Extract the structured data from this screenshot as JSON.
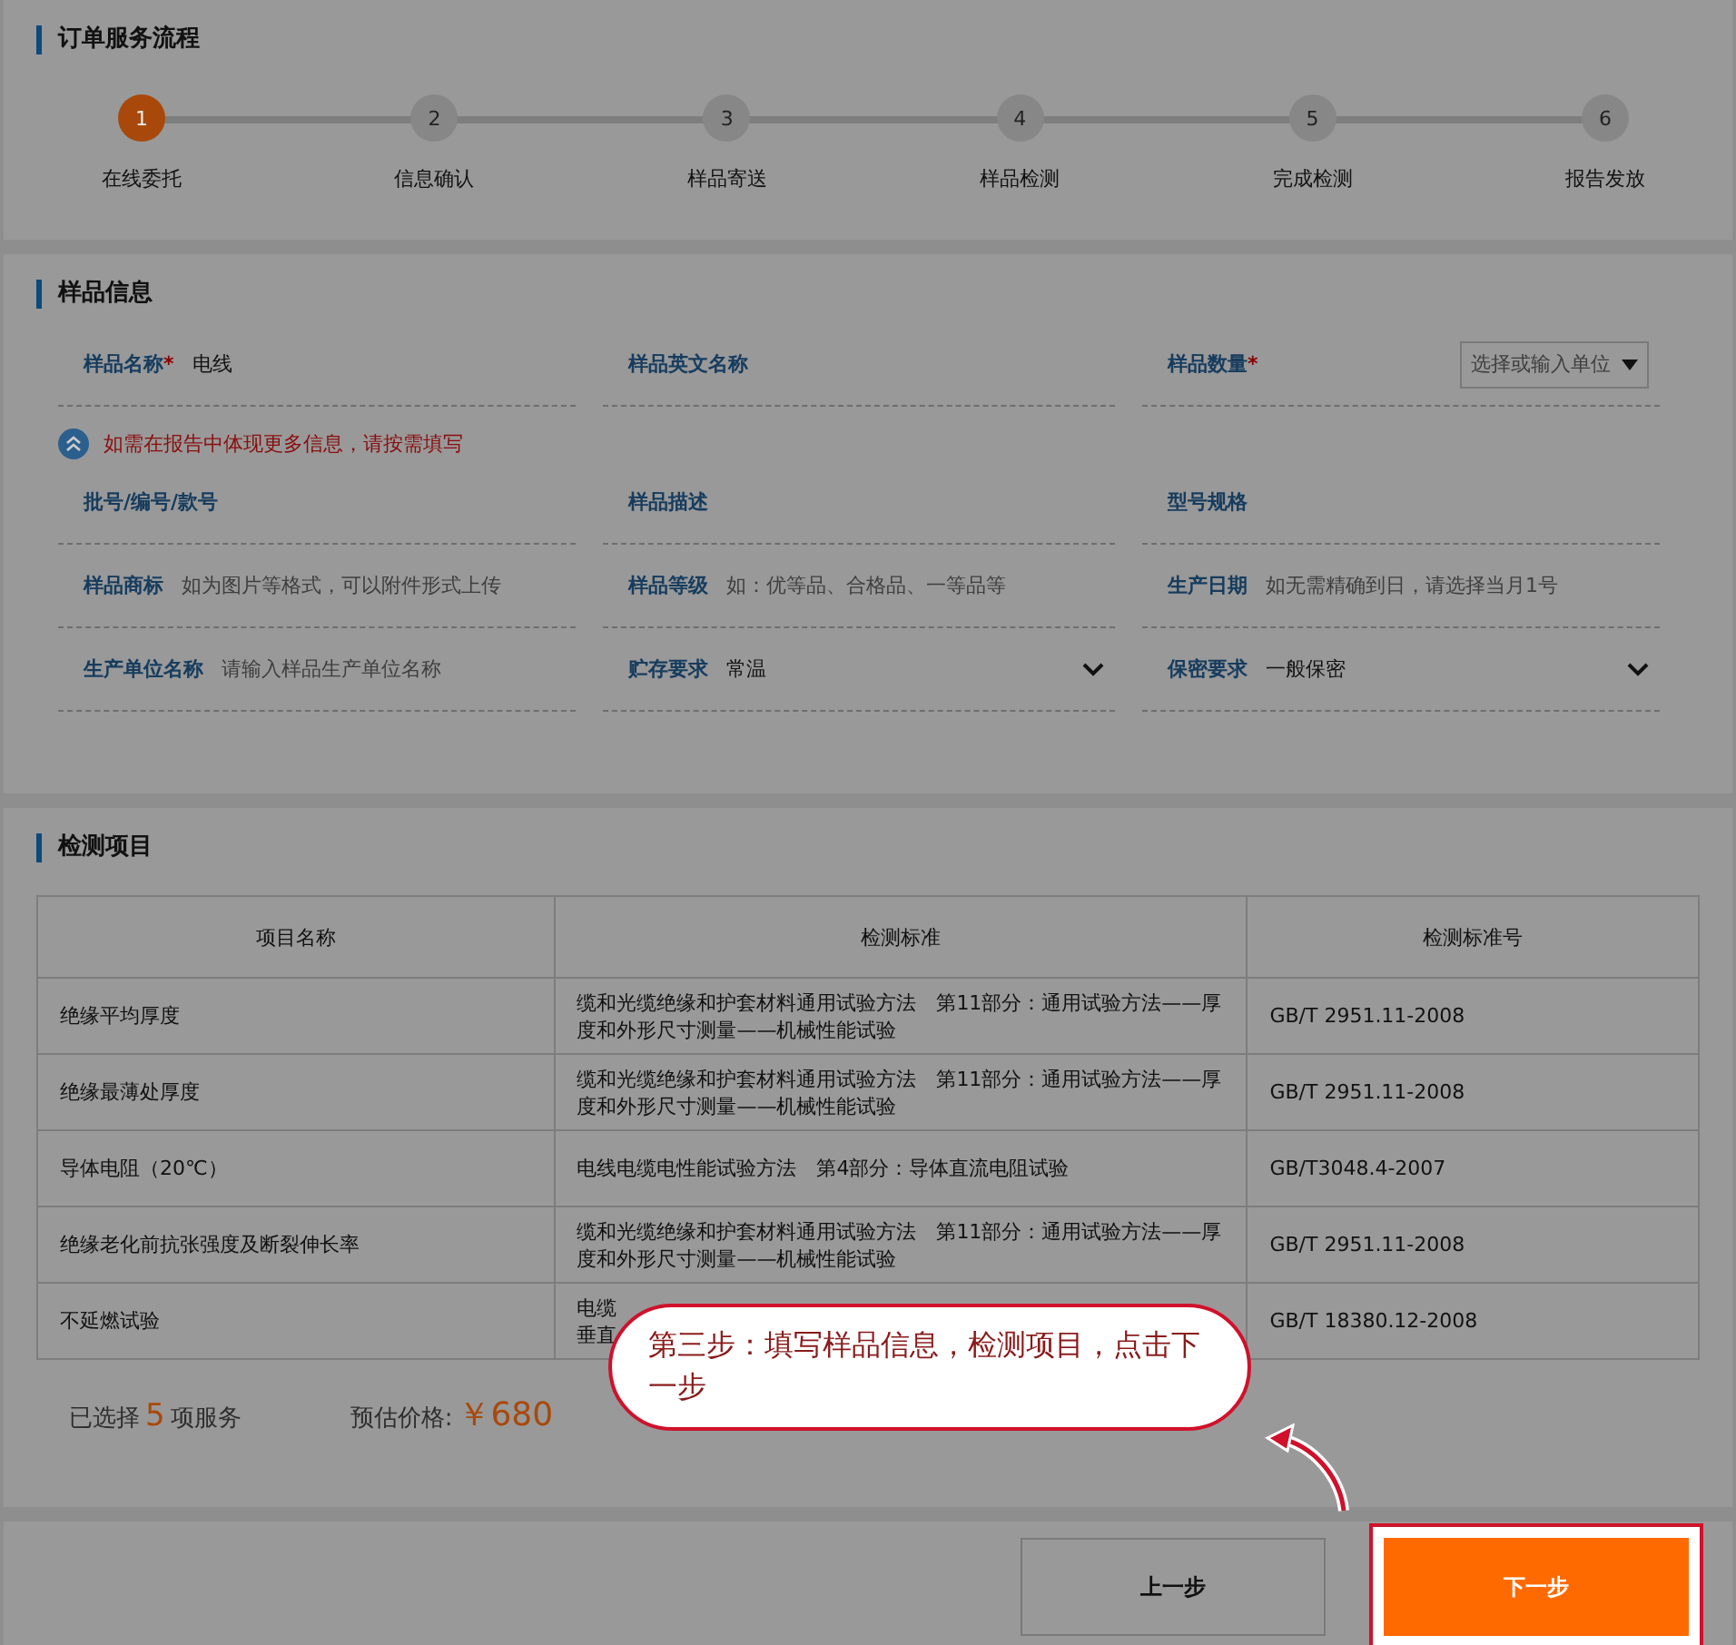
{
  "process": {
    "title": "订单服务流程",
    "steps": [
      {
        "number": "1",
        "label": "在线委托",
        "selected": true
      },
      {
        "number": "2",
        "label": "信息确认",
        "selected": false
      },
      {
        "number": "3",
        "label": "样品寄送",
        "selected": false
      },
      {
        "number": "4",
        "label": "样品检测",
        "selected": false
      },
      {
        "number": "5",
        "label": "完成检测",
        "selected": false
      },
      {
        "number": "6",
        "label": "报告发放",
        "selected": false
      }
    ]
  },
  "sample": {
    "title": "样品信息",
    "main_fields": [
      {
        "kind": "text",
        "label": "样品名称",
        "required_mark": "*",
        "value": "电线"
      },
      {
        "kind": "text",
        "label": "样品英文名称"
      },
      {
        "kind": "unit",
        "label": "样品数量",
        "required_mark": "*",
        "placeholder": "选择或输入单位"
      }
    ],
    "more_hint": "如需在报告中体现更多信息，请按需填写",
    "extra_fields": [
      {
        "kind": "text",
        "label": "批号/编号/款号"
      },
      {
        "kind": "text",
        "label": "样品描述"
      },
      {
        "kind": "text",
        "label": "型号规格"
      },
      {
        "kind": "text",
        "label": "样品商标",
        "placeholder": "如为图片等格式，可以附件形式上传"
      },
      {
        "kind": "text",
        "label": "样品等级",
        "placeholder": "如：优等品、合格品、一等品等"
      },
      {
        "kind": "text",
        "label": "生产日期",
        "placeholder": "如无需精确到日，请选择当月1号"
      },
      {
        "kind": "text",
        "label": "生产单位名称",
        "placeholder": "请输入样品生产单位名称"
      },
      {
        "kind": "select",
        "label": "贮存要求",
        "value": "常温"
      },
      {
        "kind": "select",
        "label": "保密要求",
        "value": "一般保密"
      }
    ]
  },
  "tests": {
    "title": "检测项目",
    "columns": [
      "项目名称",
      "检测标准",
      "检测标准号"
    ],
    "rows": [
      {
        "name": "绝缘平均厚度",
        "standard": [
          "缆和光缆绝缘和护套材料通用试验方法　第11部分：通用试验方法——厚",
          "度和外形尺寸测量——机械性能试验"
        ],
        "code": "GB/T 2951.11-2008"
      },
      {
        "name": "绝缘最薄处厚度",
        "standard": [
          "缆和光缆绝缘和护套材料通用试验方法　第11部分：通用试验方法——厚",
          "度和外形尺寸测量——机械性能试验"
        ],
        "code": "GB/T 2951.11-2008"
      },
      {
        "name": "导体电阻（20℃）",
        "standard": [
          "电线电缆电性能试验方法　第4部分：导体直流电阻试验"
        ],
        "code": "GB/T3048.4-2007"
      },
      {
        "name": "绝缘老化前抗张强度及断裂伸长率",
        "standard": [
          "缆和光缆绝缘和护套材料通用试验方法　第11部分：通用试验方法——厚",
          "度和外形尺寸测量——机械性能试验"
        ],
        "code": "GB/T 2951.11-2008"
      },
      {
        "name": "不延燃试验",
        "standard": [
          "电缆",
          "垂直"
        ],
        "code": "GB/T 18380.12-2008"
      }
    ],
    "summary": {
      "selected_prefix": "已选择",
      "selected_count": "5",
      "selected_suffix": "项服务",
      "price_label": "预估价格:",
      "price": "￥680"
    }
  },
  "buttons": {
    "prev": "上一步",
    "next": "下一步"
  },
  "callout": "第三步：填写样品信息，检测项目，点击下一步"
}
